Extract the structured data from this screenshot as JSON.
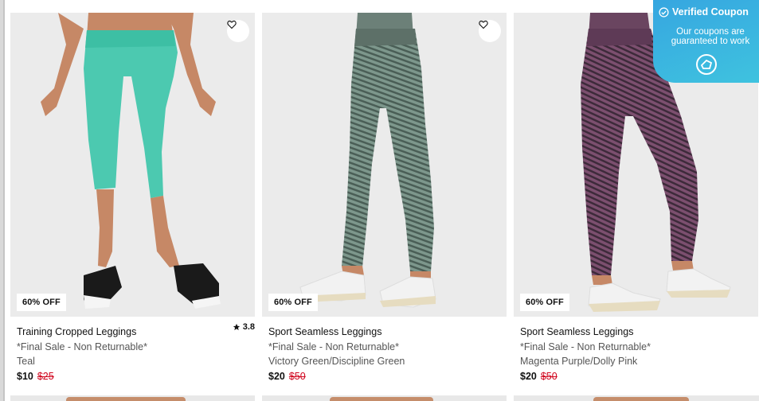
{
  "products": [
    {
      "name": "Training Cropped Leggings",
      "note": "*Final Sale - Non Returnable*",
      "color": "Teal",
      "price": "$10",
      "original_price": "$25",
      "discount": "60% OFF",
      "rating": "3.8",
      "product_color_hex": "#4cc9b0"
    },
    {
      "name": "Sport Seamless Leggings",
      "note": "*Final Sale - Non Returnable*",
      "color": "Victory Green/Discipline Green",
      "price": "$20",
      "original_price": "$50",
      "discount": "60% OFF",
      "product_color_hex": "#6f8a80"
    },
    {
      "name": "Sport Seamless Leggings",
      "note": "*Final Sale - Non Returnable*",
      "color": "Magenta Purple/Dolly Pink",
      "price": "$20",
      "original_price": "$50",
      "discount": "60% OFF",
      "product_color_hex": "#6a4560"
    }
  ],
  "coupon_popup": {
    "title": "Verified Coupon",
    "message": "Our coupons are guaranteed to work"
  },
  "colors": {
    "sale_price": "#d0021b",
    "coupon_gradient_start": "#36a6e0",
    "coupon_gradient_end": "#3fc3df",
    "image_bg": "#ebebeb"
  },
  "icons": [
    "heart-icon",
    "star-icon",
    "check-circle-icon",
    "coupon-logo-icon"
  ]
}
